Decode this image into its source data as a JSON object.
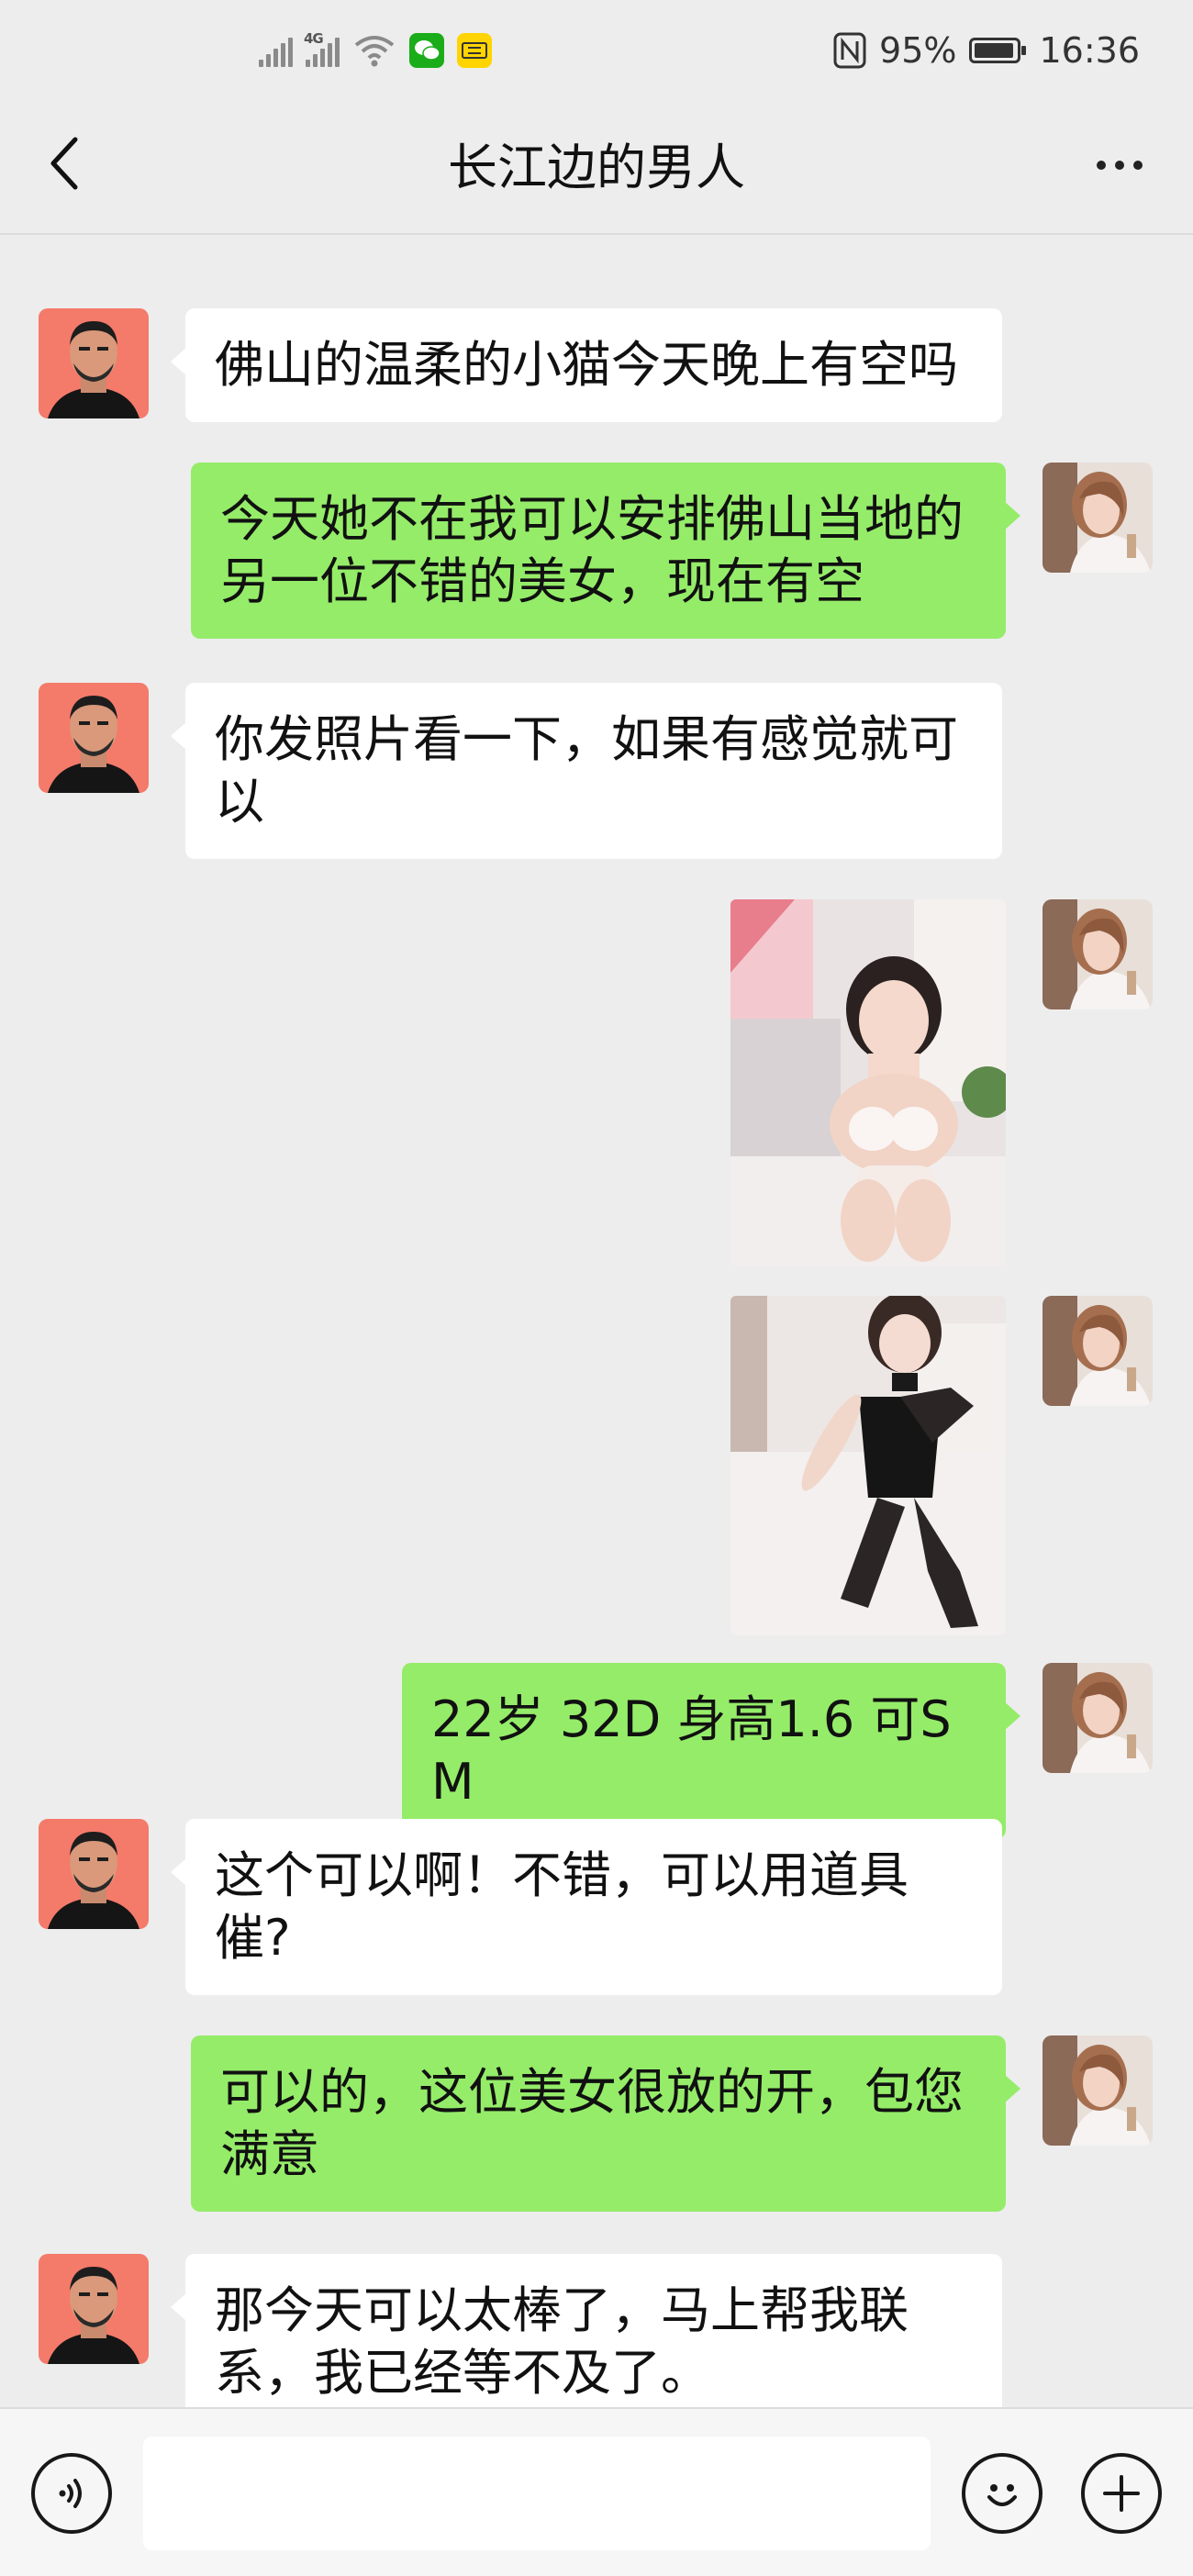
{
  "status_bar": {
    "network_label": "4G",
    "battery_percent": "95%",
    "battery_level": 0.95,
    "time": "16:36",
    "icons": [
      "signal-icon",
      "signal-4g-icon",
      "wifi-icon",
      "wechat-icon",
      "app-notification-icon",
      "nfc-icon",
      "battery-icon"
    ]
  },
  "header": {
    "back_icon": "chevron-left-icon",
    "title": "长江边的男人",
    "more_icon": "more-dots-icon"
  },
  "messages": [
    {
      "side": "left",
      "type": "text",
      "text": "佛山的温柔的小猫今天晚上有空吗"
    },
    {
      "side": "right",
      "type": "text",
      "text": "今天她不在我可以安排佛山当地的另一位不错的美女，现在有空"
    },
    {
      "side": "left",
      "type": "text",
      "text": "你发照片看一下，如果有感觉就可以"
    },
    {
      "side": "right",
      "type": "image"
    },
    {
      "side": "right",
      "type": "image"
    },
    {
      "side": "right",
      "type": "text",
      "text": "22岁 32D 身高1.6 可SM"
    },
    {
      "side": "left",
      "type": "text",
      "text": "这个可以啊！不错，可以用道具催?"
    },
    {
      "side": "right",
      "type": "text",
      "text": "可以的，这位美女很放的开，包您满意"
    },
    {
      "side": "left",
      "type": "text",
      "text": "那今天可以太棒了，马上帮我联系，我已经等不及了。"
    }
  ],
  "input_bar": {
    "voice_icon": "voice-icon",
    "input_value": "",
    "emoji_icon": "emoji-icon",
    "add_icon": "plus-icon"
  },
  "colors": {
    "background": "#ededed",
    "bubble_sent": "#95ec69",
    "bubble_received": "#ffffff",
    "contact_avatar_bg": "#f47a6a"
  }
}
